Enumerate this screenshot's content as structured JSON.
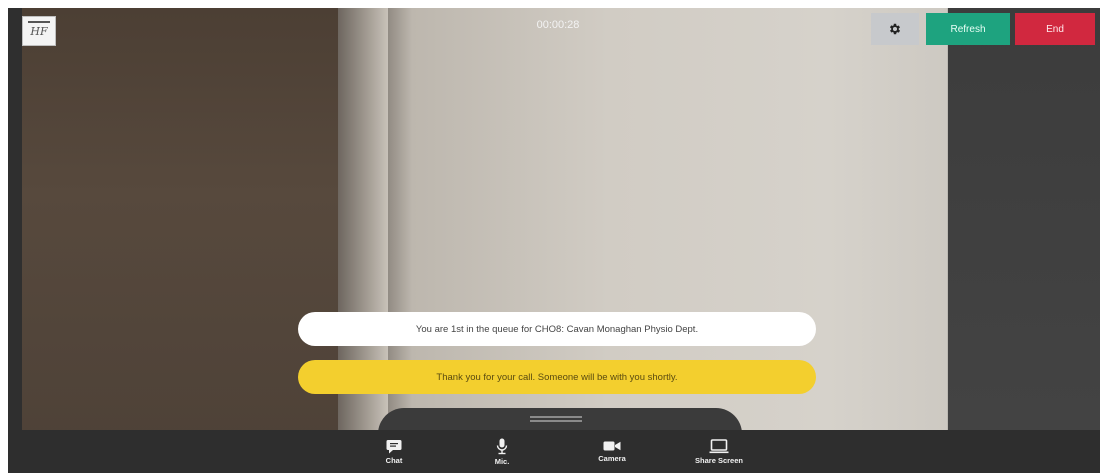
{
  "header": {
    "logo_text": "HF",
    "timer": "00:00:28",
    "settings_icon": "gear-icon",
    "refresh_label": "Refresh",
    "end_label": "End"
  },
  "messages": {
    "queue": "You are 1st in the queue for CHO8: Cavan Monaghan Physio Dept.",
    "thanks": "Thank you for your call. Someone will be with you shortly."
  },
  "toolbar": {
    "items": [
      {
        "label": "Chat",
        "icon": "chat-icon"
      },
      {
        "label": "Mic.",
        "icon": "microphone-icon"
      },
      {
        "label": "Camera",
        "icon": "camera-icon"
      },
      {
        "label": "Share Screen",
        "icon": "screen-share-icon"
      }
    ]
  },
  "colors": {
    "refresh": "#1ea37f",
    "end": "#d1283f",
    "thanks_banner": "#f3cf2e",
    "toolbar": "#2e2e2e"
  }
}
